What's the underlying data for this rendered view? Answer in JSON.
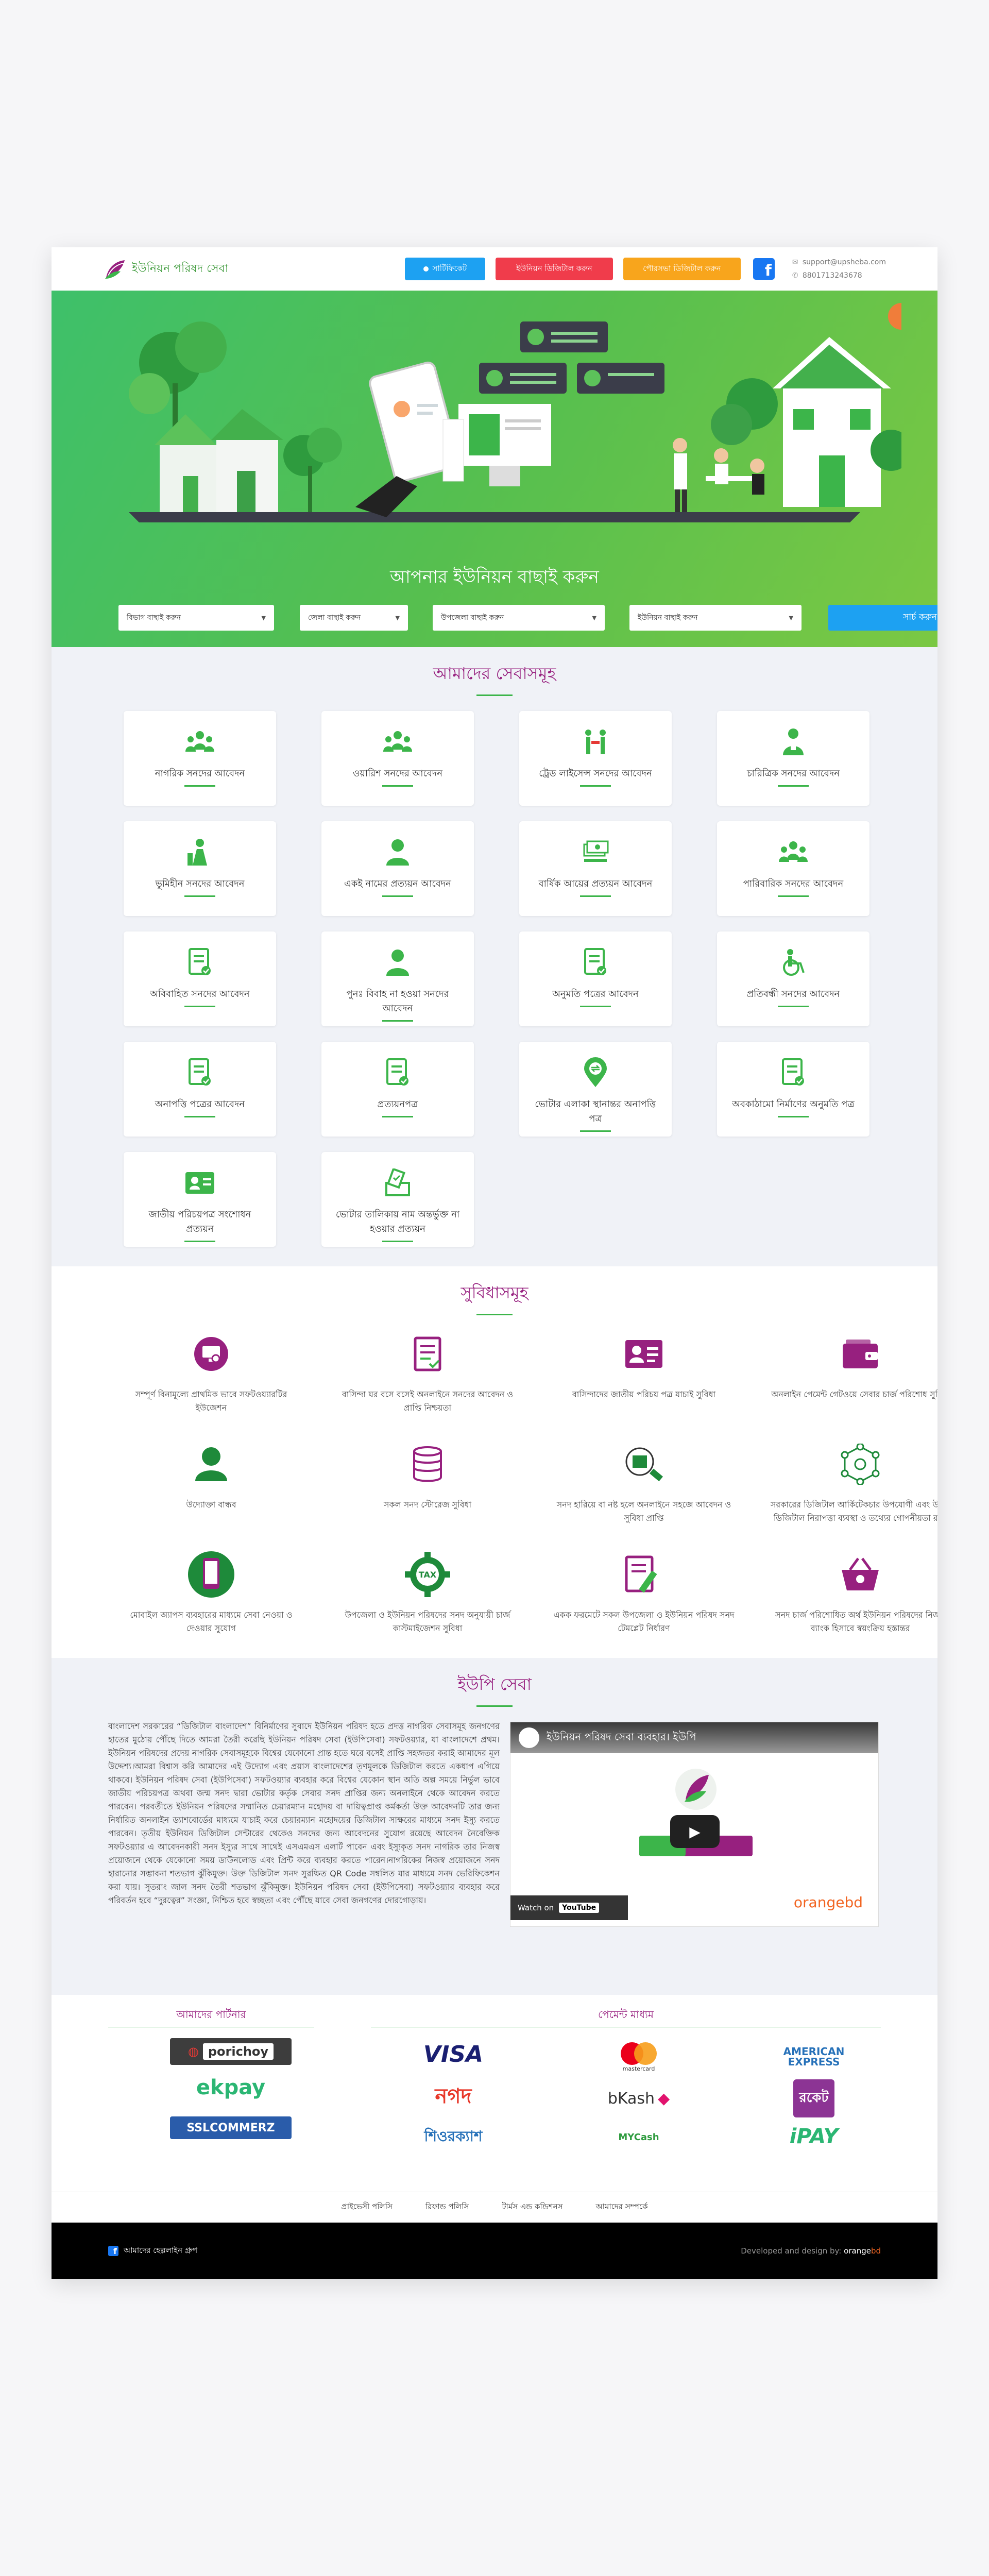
{
  "header": {
    "logo_text": "ইউনিয়ন পরিষদ সেবা",
    "buttons": {
      "certificate": "সার্টিফিকেট",
      "union_digital": "ইউনিয়ন ডিজিটাল করুন",
      "pourashava_digital": "পৌরসভা ডিজিটাল করুন"
    },
    "email": "support@upsheba.com",
    "phone": "8801713243678"
  },
  "hero": {
    "title": "আপনার ইউনিয়ন বাছাই করুন",
    "selects": [
      "বিভাগ বাছাই করুন",
      "জেলা বাছাই করুন",
      "উপজেলা বাছাই করুন",
      "ইউনিয়ন বাছাই করুন"
    ],
    "search_button": "সার্চ করুন"
  },
  "services": {
    "title": "আমাদের সেবাসমূহ",
    "items": [
      {
        "label": "নাগরিক সনদের আবেদন",
        "icon": "people-group-icon"
      },
      {
        "label": "ওয়ারিশ সনদের আবেদন",
        "icon": "family-group-icon"
      },
      {
        "label": "ট্রেড লাইসেন্স সনদের আবেদন",
        "icon": "trade-license-icon"
      },
      {
        "label": "চারিত্রিক সনদের আবেদন",
        "icon": "character-person-icon"
      },
      {
        "label": "ভূমিহীন সনদের আবেদন",
        "icon": "landless-person-icon"
      },
      {
        "label": "একই নামের প্রত্যয়ন আবেদন",
        "icon": "person-icon"
      },
      {
        "label": "বার্ষিক আয়ের প্রত্যয়ন আবেদন",
        "icon": "money-income-icon"
      },
      {
        "label": "পারিবারিক সনদের আবেদন",
        "icon": "family-icon"
      },
      {
        "label": "অবিবাহিত সনদের আবেদন",
        "icon": "document-check-icon"
      },
      {
        "label": "পুনঃ বিবাহ না হওয়া সনদের আবেদন",
        "icon": "person-icon"
      },
      {
        "label": "অনুমতি পত্রের আবেদন",
        "icon": "document-check-icon"
      },
      {
        "label": "প্রতিবন্ধী সনদের আবেদন",
        "icon": "wheelchair-icon"
      },
      {
        "label": "অনাপত্তি পত্রের আবেদন",
        "icon": "document-check-icon"
      },
      {
        "label": "প্রত্যয়নপত্র",
        "icon": "document-check-icon"
      },
      {
        "label": "ভোটার এলাকা স্থানান্তর অনাপত্তি পত্র",
        "icon": "location-transfer-icon"
      },
      {
        "label": "অবকাঠামো নির্মাণের অনুমতি পত্র",
        "icon": "document-check-icon"
      },
      {
        "label": "জাতীয় পরিচয়পত্র সংশোধন প্রত্যয়ন",
        "icon": "id-card-icon"
      },
      {
        "label": "ভোটার তালিকায় নাম অন্তর্ভুক্ত না হওয়ার প্রত্যয়ন",
        "icon": "voter-list-icon"
      }
    ]
  },
  "features": {
    "title": "সুবিধাসমূহ",
    "items": [
      {
        "text": "সম্পূর্ণ বিনামূল্যে প্রাথমিক ভাবে সফটওয়্যারটির ইউজেশন",
        "icon": "monitor-settings-icon",
        "color": "#97207f"
      },
      {
        "text": "বাসিন্দা ঘর বসে বসেই অনলাইনে সনদের আবেদন ও প্রাপ্তি নিশ্চয়তা",
        "icon": "document-list-icon",
        "color": "#97207f"
      },
      {
        "text": "বাসিন্দাদের জাতীয় পরিচয় পত্র যাচাই সুবিধা",
        "icon": "id-card-icon",
        "color": "#97207f"
      },
      {
        "text": "অনলাইন পেমেন্ট গেটওয়ে সেবার চার্জ পরিশোধ সুবিধা",
        "icon": "wallet-icon",
        "color": "#97207f"
      },
      {
        "text": "উদ্যোক্তা বান্ধব",
        "icon": "user-icon",
        "color": "#1e8a3a"
      },
      {
        "text": "সকল সনদ স্টোরেজ সুবিধা",
        "icon": "database-icon",
        "color": "#97207f"
      },
      {
        "text": "সনদ হারিয়ে বা নষ্ট হলে অনলাইনে সহজে আবেদন ও সুবিধা প্রাপ্তি",
        "icon": "search-document-icon",
        "color": "#1e8a3a"
      },
      {
        "text": "সরকারের ডিজিটাল আর্কিটেকচার উপযোগী এবং উন্নত ডিজিটাল নিরাপত্তা ব্যবস্থা ও তথ্যের গোপনীয়তা রক্ষা",
        "icon": "network-icon",
        "color": "#1e8a3a"
      },
      {
        "text": "মোবাইল অ্যাপস ব্যবহারের মাধ্যমে সেবা নেওয়া ও দেওয়ার সুযোগ",
        "icon": "mobile-app-icon",
        "color": "#1e8a3a"
      },
      {
        "text": "উপজেলা ও ইউনিয়ন পরিষদের সনদ অনুযায়ী চার্জ কাস্টমাইজেশন সুবিধা",
        "icon": "tax-gear-icon",
        "color": "#1e8a3a"
      },
      {
        "text": "একক ফরমেটে সকল উপজেলা ও ইউনিয়ন পরিষদ সনদ টেমপ্লেট নির্ধারণ",
        "icon": "document-edit-icon",
        "color": "#97207f"
      },
      {
        "text": "সনদ চার্জ পরিশোধিত অর্থ ইউনিয়ন পরিষদের নিজস্ব ব্যাংক হিসাবে স্বয়ংক্রিয় হস্তান্তর",
        "icon": "basket-icon",
        "color": "#97207f"
      }
    ]
  },
  "upseba": {
    "title": "ইউপি সেবা",
    "paragraph": "বাংলাদেশ সরকারের “ডিজিটাল বাংলাদেশ” বিনির্মাণের সুবাদে ইউনিয়ন পরিষদ হতে প্রদত্ত নাগরিক সেবাসমূহ জনগণের হাতের মুঠোয় পৌঁছে দিতে আমরা তৈরী করেছি ইউনিয়ন পরিষদ সেবা (ইউপিসেবা) সফটওয়্যার, যা বাংলাদেশে প্রথম। ইউনিয়ন পরিষদের প্রদেয় নাগরিক সেবাসমূহকে বিশ্বের যেকোনো প্রান্ত হতে ঘরে বসেই প্রাপ্তি সহজতর করাই আমাদের মূল উদ্দেশ্য।আমরা বিশ্বাস করি আমাদের এই উদ্যোগ এবং প্রয়াস বাংলাদেশের তৃণমূলকে ডিজিটাল করতে একধাপ এগিয়ে থাকবে। ইউনিয়ন পরিষদ সেবা (ইউপিসেবা) সফটওয়্যার ব্যবহার করে বিশ্বের যেকোন স্থান অতি অল্প সময়ে নির্ভুল ভাবে জাতীয় পরিচয়পত্র অথবা জন্ম সনদ দ্বারা ভোটার কর্তৃক সেবার সনদ প্রাপ্তির জন্য অনলাইনে থেকে আবেদন করতে পারবেন। পরবর্তীতে ইউনিয়ন পরিষদের সম্মানিত চেয়ারম্যান মহোদয় বা দায়িত্বপ্রাপ্ত কর্মকর্তা উক্ত আবেদনটি তার জন্য নির্ধারিত অনলাইন ড্যাশবোর্ডের মাধ্যমে যাচাই করে চেয়ারম্যান মহোদয়ের ডিজিটাল সাক্ষরের মাধ্যমে সনদ ইস্যু করতে পারবেন। তৃতীয় ইউনিয়ন ডিজিটাল সেন্টারের থেকেও সনদের জন্য আবেদনের সুযোগ রয়েছে আবেদন নৈবেক্তিক সফটওয়্যার এ আবেদনকারী সনদ ইস্যুর সাথে সাথেই এসএমএস এলার্ট পাবেন এবং ইস্যুকৃত সনদ নাগরিক তার নিজস্ব প্রয়োজনে থেকে যেকোনো সময় ডাউনলোড এবং প্রিন্ট করে ব্যবহার করতে পারেন।নাগরিকের নিজস্ব প্রয়োজনে সনদ হারানোর সম্ভাবনা শতভাগ ঝুঁকিমুক্ত। উক্ত ডিজিটাল সনদ সুরক্ষিত QR Code সম্বলিত যার মাধ্যমে সনদ ভেরিফিকেশন করা যায়। সুতরাং জাল সনদ তৈরী শতভাগ ঝুঁকিমুক্ত। ইউনিয়ন পরিষদ সেবা (ইউপিসেবা) সফটওয়্যার ব্যবহার করে পরিবর্তন হবে “দুরত্বের” সংজ্ঞা, নিশ্চিত হবে স্বচ্ছতা এবং পৌঁছে যাবে সেবা জনগণের দোরগোড়ায়।",
    "video": {
      "title": "ইউনিয়ন পরিষদ সেবা ব্যবহার। ইউপি",
      "watch_on": "Watch on",
      "youtube": "YouTube",
      "brand": "orangebd"
    }
  },
  "partners": {
    "title": "আমাদের পার্টনার",
    "items": [
      "porichoy",
      "ekpay",
      "SSLCOMMERZ"
    ]
  },
  "payment": {
    "title": "পেমেন্ট মাধ্যম",
    "items": [
      "VISA",
      "mastercard",
      "AMERICAN EXPRESS",
      "নগদ",
      "bKash",
      "রকেট",
      "শিওরক্যাশ",
      "MYCash",
      "iPAY"
    ]
  },
  "footer": {
    "links": [
      "প্রাইভেসী পলিসি",
      "রিফান্ড পলিসি",
      "টার্মস এন্ড কন্ডিশনস",
      "আমাদের সম্পর্কে"
    ],
    "fb_group": "আমাদের হেল্পলাইন গ্রুপ",
    "developed_by": "Developed and design by:",
    "dev_brand_a": "orange",
    "dev_brand_b": "bd"
  }
}
